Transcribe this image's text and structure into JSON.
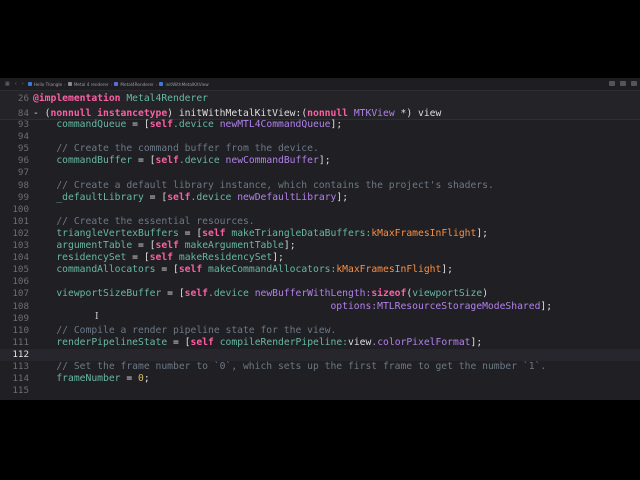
{
  "jumpbar": {
    "crumbs": [
      "Hello Triangle",
      "Metal 4 renderer",
      "Metal4Renderer",
      "initWithMetalKitView"
    ],
    "crumb_colors": [
      "#3b7bd8",
      "#8a8a90",
      "#5a6fd0",
      "#3b7bd8"
    ]
  },
  "sticky": [
    {
      "n": "26",
      "tokens": [
        [
          "k",
          "@implementation"
        ],
        [
          "x",
          " "
        ],
        [
          "p",
          "Metal4Renderer"
        ]
      ]
    },
    {
      "n": "84",
      "tokens": [
        [
          "x",
          "- ("
        ],
        [
          "k",
          "nonnull"
        ],
        [
          "x",
          " "
        ],
        [
          "k",
          "instancetype"
        ],
        [
          "x",
          ") initWithMetalKitView:("
        ],
        [
          "k",
          "nonnull"
        ],
        [
          "x",
          " "
        ],
        [
          "m",
          "MTKView"
        ],
        [
          "x",
          " *) view"
        ]
      ]
    }
  ],
  "lines": [
    {
      "n": "93",
      "tokens": [
        [
          "x",
          "    "
        ],
        [
          "p",
          "commandQueue"
        ],
        [
          "x",
          " = ["
        ],
        [
          "k",
          "self"
        ],
        [
          "p",
          ".device"
        ],
        [
          "x",
          " "
        ],
        [
          "m",
          "newMTL4CommandQueue"
        ],
        [
          "x",
          "];"
        ]
      ]
    },
    {
      "n": "94",
      "tokens": []
    },
    {
      "n": "95",
      "tokens": [
        [
          "x",
          "    "
        ],
        [
          "c",
          "// Create the command buffer from the device."
        ]
      ]
    },
    {
      "n": "96",
      "tokens": [
        [
          "x",
          "    "
        ],
        [
          "p",
          "commandBuffer"
        ],
        [
          "x",
          " = ["
        ],
        [
          "k",
          "self"
        ],
        [
          "p",
          ".device"
        ],
        [
          "x",
          " "
        ],
        [
          "m",
          "newCommandBuffer"
        ],
        [
          "x",
          "];"
        ]
      ]
    },
    {
      "n": "97",
      "tokens": []
    },
    {
      "n": "98",
      "tokens": [
        [
          "x",
          "    "
        ],
        [
          "c",
          "// Create a default library instance, which contains the project's shaders."
        ]
      ]
    },
    {
      "n": "99",
      "tokens": [
        [
          "x",
          "    "
        ],
        [
          "p",
          "_defaultLibrary"
        ],
        [
          "x",
          " = ["
        ],
        [
          "k",
          "self"
        ],
        [
          "p",
          ".device"
        ],
        [
          "x",
          " "
        ],
        [
          "m",
          "newDefaultLibrary"
        ],
        [
          "x",
          "];"
        ]
      ]
    },
    {
      "n": "100",
      "tokens": []
    },
    {
      "n": "101",
      "tokens": [
        [
          "x",
          "    "
        ],
        [
          "c",
          "// Create the essential resources."
        ]
      ]
    },
    {
      "n": "102",
      "tokens": [
        [
          "x",
          "    "
        ],
        [
          "p",
          "triangleVertexBuffers"
        ],
        [
          "x",
          " = ["
        ],
        [
          "k",
          "self"
        ],
        [
          "x",
          " "
        ],
        [
          "p",
          "makeTriangleDataBuffers:"
        ],
        [
          "o",
          "kMaxFramesInFlight"
        ],
        [
          "x",
          "];"
        ]
      ]
    },
    {
      "n": "103",
      "tokens": [
        [
          "x",
          "    "
        ],
        [
          "p",
          "argumentTable"
        ],
        [
          "x",
          " = ["
        ],
        [
          "k",
          "self"
        ],
        [
          "x",
          " "
        ],
        [
          "p",
          "makeArgumentTable"
        ],
        [
          "x",
          "];"
        ]
      ]
    },
    {
      "n": "104",
      "tokens": [
        [
          "x",
          "    "
        ],
        [
          "p",
          "residencySet"
        ],
        [
          "x",
          " = ["
        ],
        [
          "k",
          "self"
        ],
        [
          "x",
          " "
        ],
        [
          "p",
          "makeResidencySet"
        ],
        [
          "x",
          "];"
        ]
      ]
    },
    {
      "n": "105",
      "tokens": [
        [
          "x",
          "    "
        ],
        [
          "p",
          "commandAllocators"
        ],
        [
          "x",
          " = ["
        ],
        [
          "k",
          "self"
        ],
        [
          "x",
          " "
        ],
        [
          "p",
          "makeCommandAllocators:"
        ],
        [
          "o",
          "kMaxFramesInFlight"
        ],
        [
          "x",
          "];"
        ]
      ]
    },
    {
      "n": "106",
      "tokens": []
    },
    {
      "n": "107",
      "tokens": [
        [
          "x",
          "    "
        ],
        [
          "p",
          "viewportSizeBuffer"
        ],
        [
          "x",
          " = ["
        ],
        [
          "k",
          "self"
        ],
        [
          "p",
          ".device"
        ],
        [
          "x",
          " "
        ],
        [
          "m",
          "newBufferWithLength:"
        ],
        [
          "k",
          "sizeof"
        ],
        [
          "x",
          "("
        ],
        [
          "p",
          "viewportSize"
        ],
        [
          "x",
          ")"
        ]
      ]
    },
    {
      "n": "108",
      "tokens": [
        [
          "x",
          "                                                   "
        ],
        [
          "m",
          "options:MTLResourceStorageModeShared"
        ],
        [
          "x",
          "];"
        ]
      ]
    },
    {
      "n": "109",
      "tokens": []
    },
    {
      "n": "110",
      "tokens": [
        [
          "x",
          "    "
        ],
        [
          "c",
          "// Compile a render pipeline state for the view."
        ]
      ]
    },
    {
      "n": "111",
      "tokens": [
        [
          "x",
          "    "
        ],
        [
          "p",
          "renderPipelineState"
        ],
        [
          "x",
          " = ["
        ],
        [
          "k",
          "self"
        ],
        [
          "x",
          " "
        ],
        [
          "p",
          "compileRenderPipeline:"
        ],
        [
          "x",
          "view"
        ],
        [
          "m",
          ".colorPixelFormat"
        ],
        [
          "x",
          "];"
        ]
      ]
    },
    {
      "n": "112",
      "tokens": [],
      "current": true
    },
    {
      "n": "113",
      "tokens": [
        [
          "x",
          "    "
        ],
        [
          "c",
          "// Set the frame number to `0`, which sets up the first frame to get the number `1`."
        ]
      ]
    },
    {
      "n": "114",
      "tokens": [
        [
          "x",
          "    "
        ],
        [
          "p",
          "frameNumber"
        ],
        [
          "x",
          " = "
        ],
        [
          "n",
          "0"
        ],
        [
          "x",
          ";"
        ]
      ]
    },
    {
      "n": "115",
      "tokens": []
    }
  ]
}
